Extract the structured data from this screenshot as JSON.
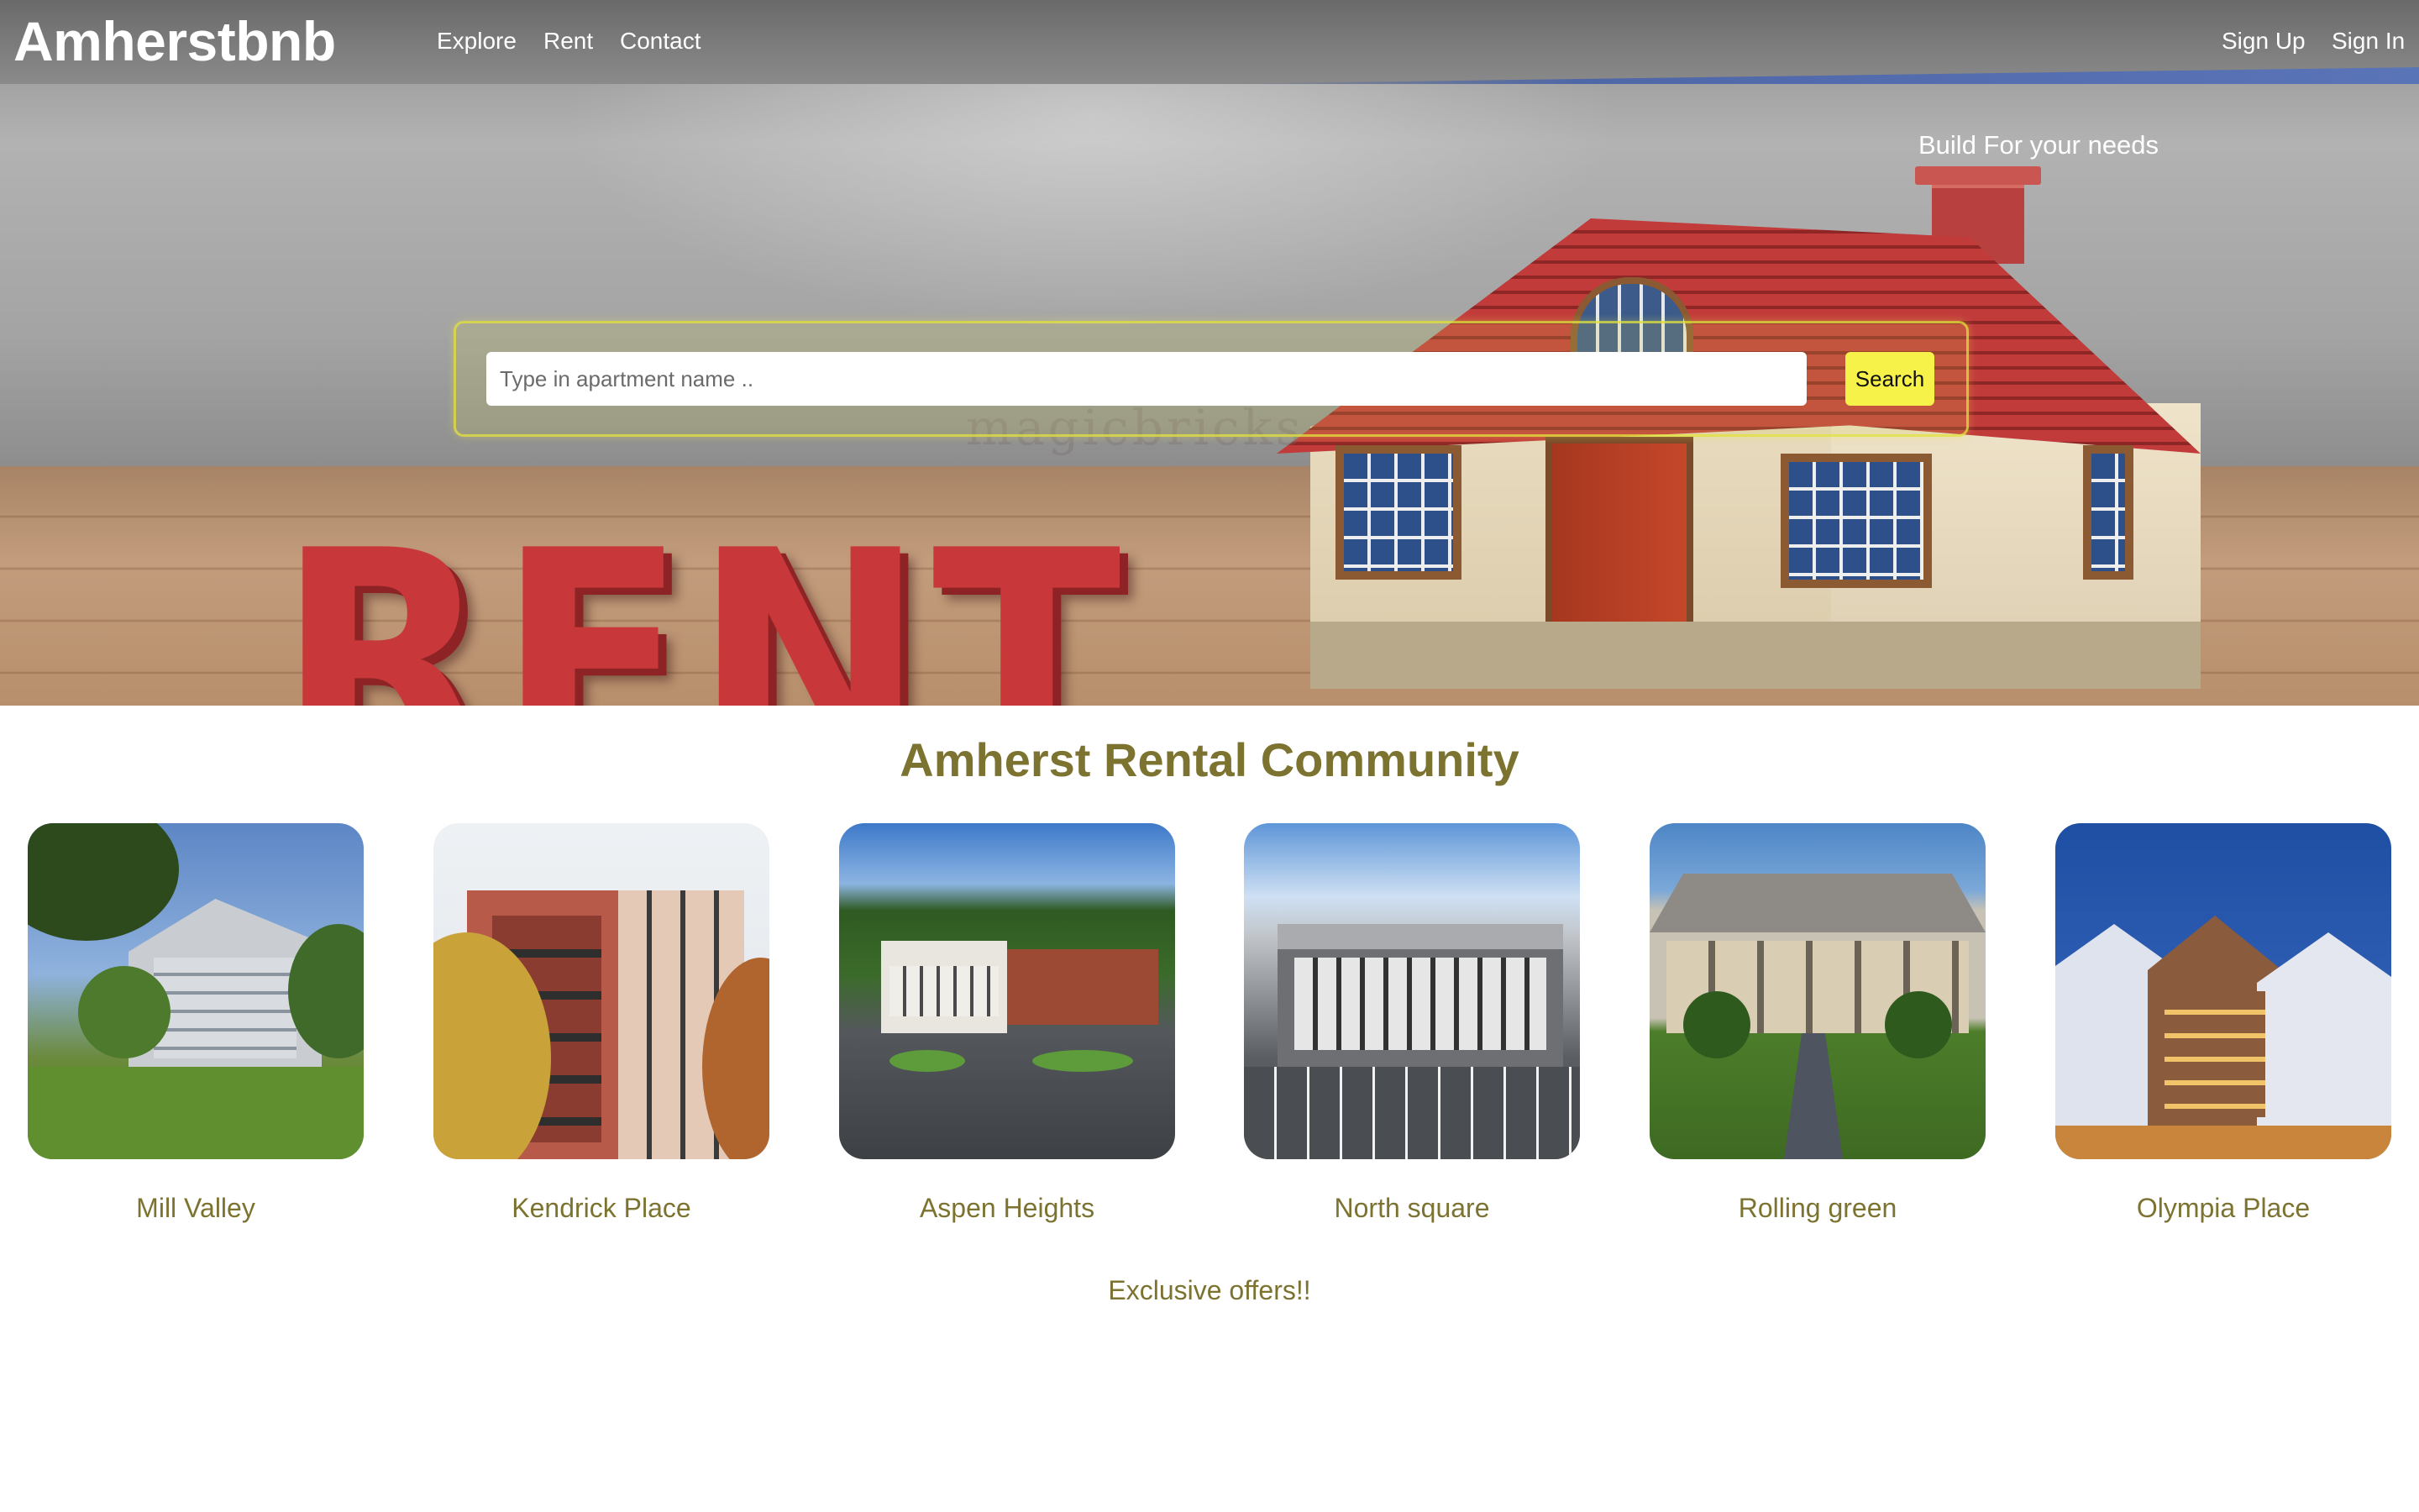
{
  "header": {
    "brand": "Amherstbnb",
    "nav_links": [
      "Explore",
      "Rent",
      "Contact"
    ],
    "auth_links": [
      "Sign Up",
      "Sign In"
    ]
  },
  "hero": {
    "tagline": "Build For your needs",
    "image_text": "RENT",
    "watermark": "magicbricks"
  },
  "search": {
    "placeholder": "Type in apartment name ..",
    "value": "",
    "button_label": "Search"
  },
  "community": {
    "title": "Amherst Rental Community",
    "listings": [
      {
        "name": "Mill Valley"
      },
      {
        "name": "Kendrick Place"
      },
      {
        "name": "Aspen Heights"
      },
      {
        "name": "North square"
      },
      {
        "name": "Rolling green"
      },
      {
        "name": "Olympia Place"
      }
    ]
  },
  "offers": {
    "label": "Exclusive offers!!"
  },
  "colors": {
    "accent_text": "#7d7331",
    "search_button": "#f7f24a",
    "nav_stripe": "#4f67a7"
  }
}
